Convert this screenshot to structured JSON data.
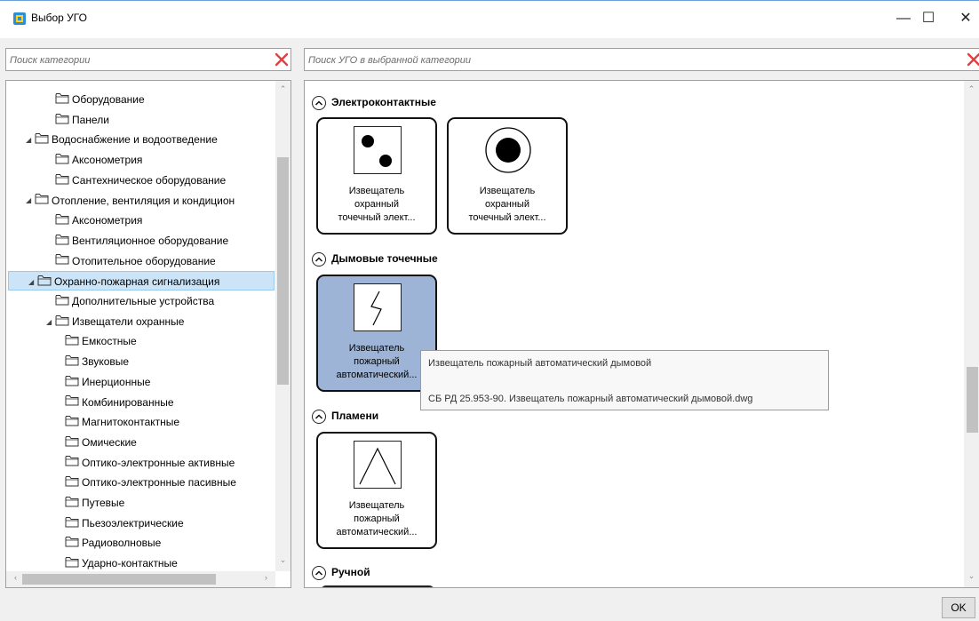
{
  "window": {
    "title": "Выбор УГО",
    "minimize": "—",
    "maximize": "☐",
    "close": "✕"
  },
  "left_search": {
    "placeholder": "Поиск категории"
  },
  "right_search": {
    "placeholder": "Поиск УГО в выбранной категории"
  },
  "tree": {
    "items": [
      {
        "label": "Оборудование",
        "level": 3,
        "expanded": null,
        "selected": false
      },
      {
        "label": "Панели",
        "level": 3,
        "expanded": null,
        "selected": false
      },
      {
        "label": "Водоснабжение и водоотведение",
        "level": 2,
        "expanded": true,
        "selected": false
      },
      {
        "label": "Аксонометрия",
        "level": 3,
        "expanded": null,
        "selected": false
      },
      {
        "label": "Сантехническое оборудование",
        "level": 3,
        "expanded": null,
        "selected": false
      },
      {
        "label": "Отопление, вентиляция и кондицион",
        "level": 2,
        "expanded": true,
        "selected": false
      },
      {
        "label": "Аксонометрия",
        "level": 3,
        "expanded": null,
        "selected": false
      },
      {
        "label": "Вентиляционное оборудование",
        "level": 3,
        "expanded": null,
        "selected": false
      },
      {
        "label": "Отопительное оборудование",
        "level": 3,
        "expanded": null,
        "selected": false
      },
      {
        "label": "Охранно-пожарная сигнализация",
        "level": 2,
        "expanded": true,
        "selected": true
      },
      {
        "label": "Дополнительные устройства",
        "level": 3,
        "expanded": null,
        "selected": false
      },
      {
        "label": "Извещатели охранные",
        "level": 3,
        "expanded": true,
        "selected": false
      },
      {
        "label": "Емкостные",
        "level": 4,
        "expanded": null,
        "selected": false
      },
      {
        "label": "Звуковые",
        "level": 4,
        "expanded": null,
        "selected": false
      },
      {
        "label": "Инерционные",
        "level": 4,
        "expanded": null,
        "selected": false
      },
      {
        "label": "Комбинированные",
        "level": 4,
        "expanded": null,
        "selected": false
      },
      {
        "label": "Магнитоконтактные",
        "level": 4,
        "expanded": null,
        "selected": false
      },
      {
        "label": "Омические",
        "level": 4,
        "expanded": null,
        "selected": false
      },
      {
        "label": "Оптико-электронные активные",
        "level": 4,
        "expanded": null,
        "selected": false
      },
      {
        "label": "Оптико-электронные пасивные",
        "level": 4,
        "expanded": null,
        "selected": false
      },
      {
        "label": "Путевые",
        "level": 4,
        "expanded": null,
        "selected": false
      },
      {
        "label": "Пьезоэлектрические",
        "level": 4,
        "expanded": null,
        "selected": false
      },
      {
        "label": "Радиоволновые",
        "level": 4,
        "expanded": null,
        "selected": false
      },
      {
        "label": "Ударно-контактные",
        "level": 4,
        "expanded": null,
        "selected": false
      }
    ]
  },
  "sections": [
    {
      "title": "Электроконтактные",
      "cards": [
        {
          "symbol": "two-dots",
          "lines": [
            "Извещатель",
            "охранный",
            "точечный элект..."
          ],
          "selected": false
        },
        {
          "symbol": "circle-dot",
          "lines": [
            "Извещатель",
            "охранный",
            "точечный элект..."
          ],
          "selected": false
        }
      ]
    },
    {
      "title": "Дымовые точечные",
      "cards": [
        {
          "symbol": "zigzag",
          "lines": [
            "Извещатель",
            "пожарный",
            "автоматический..."
          ],
          "selected": true
        }
      ]
    },
    {
      "title": "Пламени",
      "cards": [
        {
          "symbol": "triangle",
          "lines": [
            "Извещатель",
            "пожарный",
            "автоматический..."
          ],
          "selected": false
        }
      ]
    },
    {
      "title": "Ручной",
      "cards": []
    }
  ],
  "tooltip": {
    "name": "Извещатель пожарный автоматический дымовой",
    "file": "СБ РД 25.953-90. Извещатель пожарный автоматический дымовой.dwg"
  },
  "ok_label": "OK",
  "colors": {
    "selected_tree_bg": "#cce4f7",
    "selected_card_bg": "#9db4d6",
    "clear_icon": "#e04040",
    "app_icon": "#2a8fd6"
  }
}
